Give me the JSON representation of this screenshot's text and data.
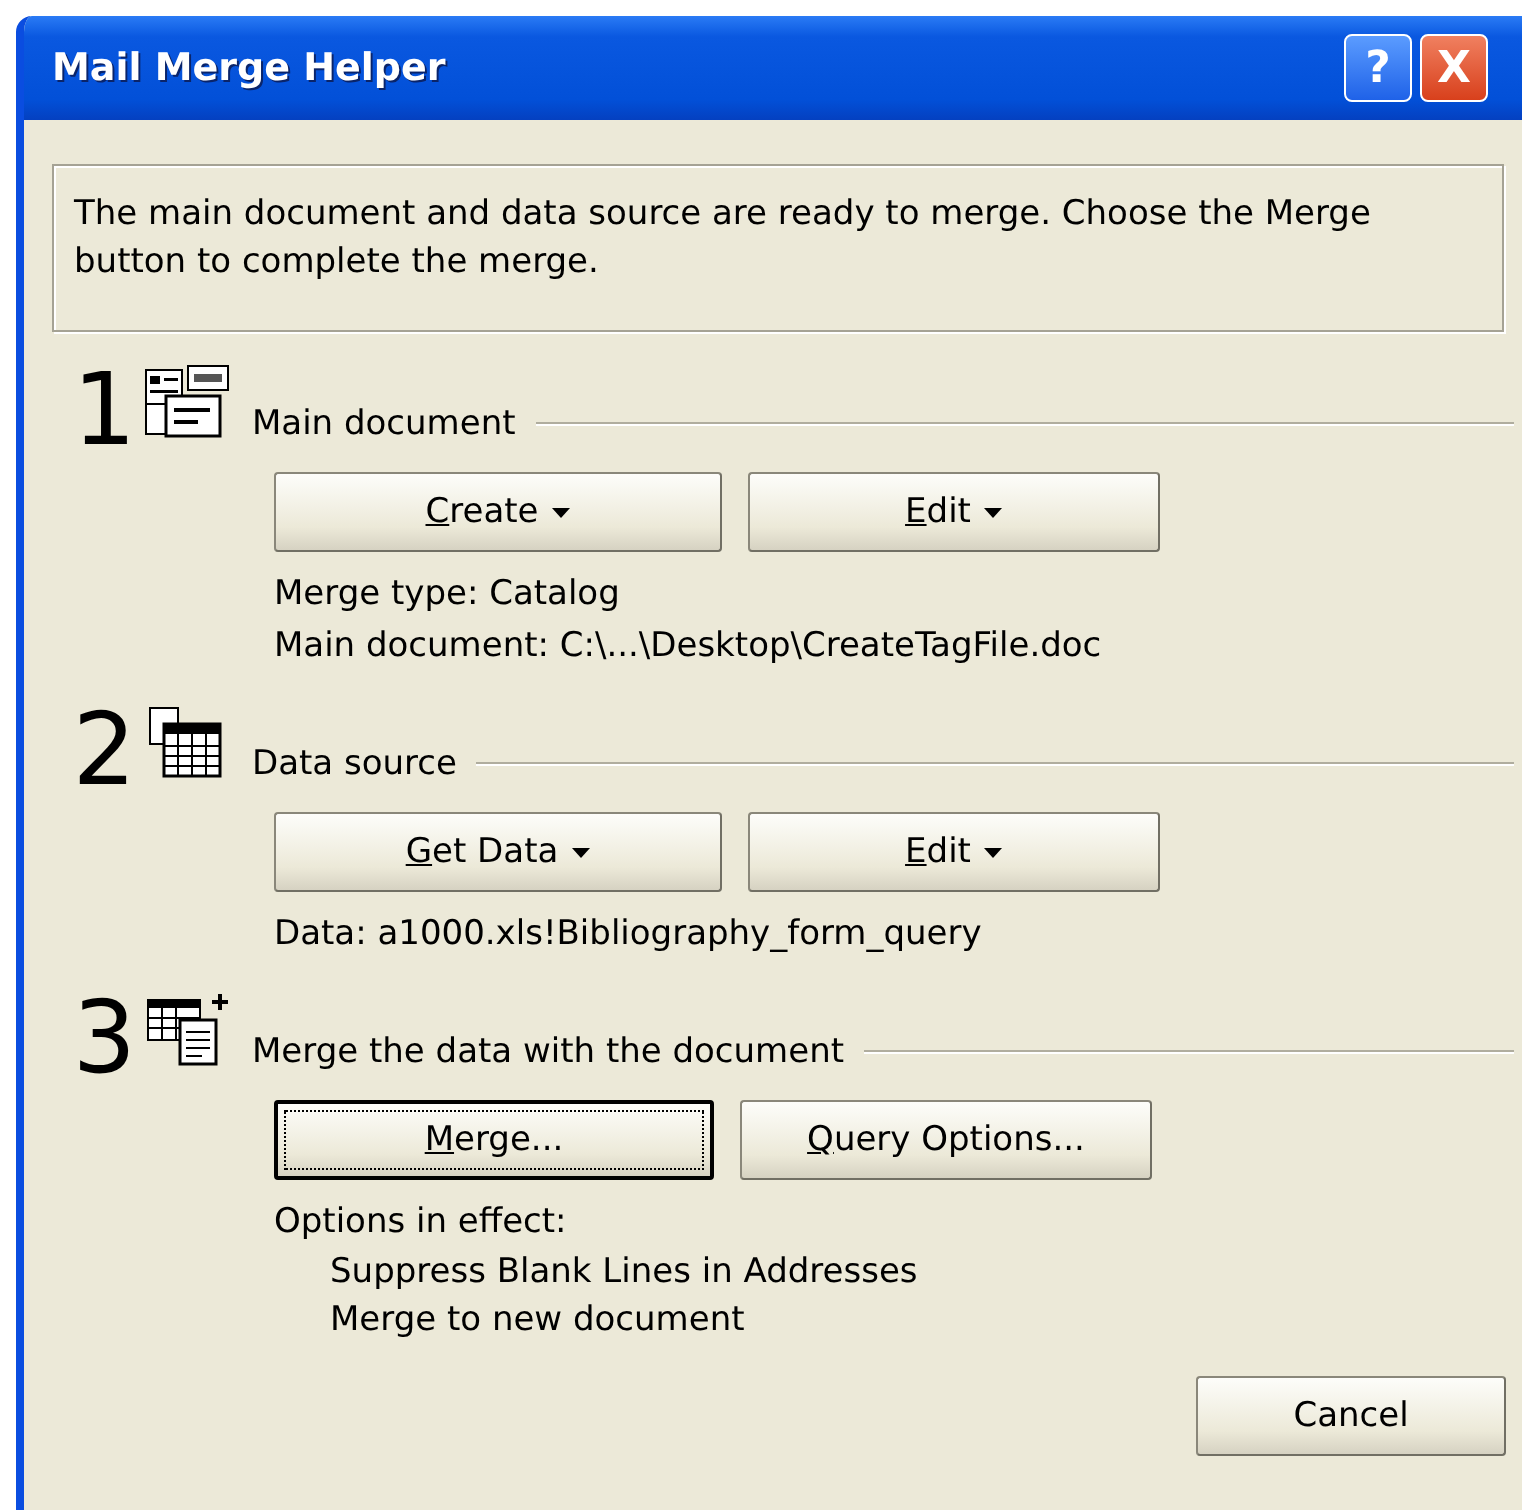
{
  "window": {
    "title": "Mail Merge Helper",
    "controls": [
      {
        "kind": "help",
        "label": "?"
      },
      {
        "kind": "close",
        "label": "X"
      }
    ]
  },
  "intro": "The main document and data source are ready to merge. Choose the Merge button to complete the merge.",
  "steps": [
    {
      "number": "1",
      "kind": "document",
      "label": "Main document",
      "buttons": [
        {
          "label": "Create",
          "access_key_underlined": true,
          "dropdown": true,
          "default": false
        },
        {
          "label": "Edit",
          "access_key_underlined": true,
          "dropdown": true,
          "default": false
        }
      ],
      "details": [
        {
          "text": "Merge type: Catalog",
          "indented": false
        },
        {
          "text": "Main document: C:\\...\\Desktop\\CreateTagFile.doc",
          "indented": false
        }
      ]
    },
    {
      "number": "2",
      "kind": "datasource",
      "label": "Data source",
      "buttons": [
        {
          "label": "Get Data",
          "access_key_underlined": true,
          "dropdown": true,
          "default": false
        },
        {
          "label": "Edit",
          "access_key_underlined": true,
          "dropdown": true,
          "default": false
        }
      ],
      "details": [
        {
          "text": "Data: a1000.xls!Bibliography_form_query",
          "indented": false
        }
      ]
    },
    {
      "number": "3",
      "kind": "merge",
      "label": "Merge the data with the document",
      "buttons": [
        {
          "label": "Merge...",
          "access_key_underlined": true,
          "dropdown": false,
          "default": true
        },
        {
          "label": "Query Options...",
          "access_key_underlined": true,
          "dropdown": false,
          "default": false
        }
      ],
      "details": [
        {
          "text": "Options in effect:",
          "indented": false
        },
        {
          "text": "Suppress Blank Lines in Addresses",
          "indented": true
        },
        {
          "text": "Merge to new document",
          "indented": true
        }
      ]
    }
  ],
  "buttons": [
    {
      "label": "Cancel"
    }
  ]
}
